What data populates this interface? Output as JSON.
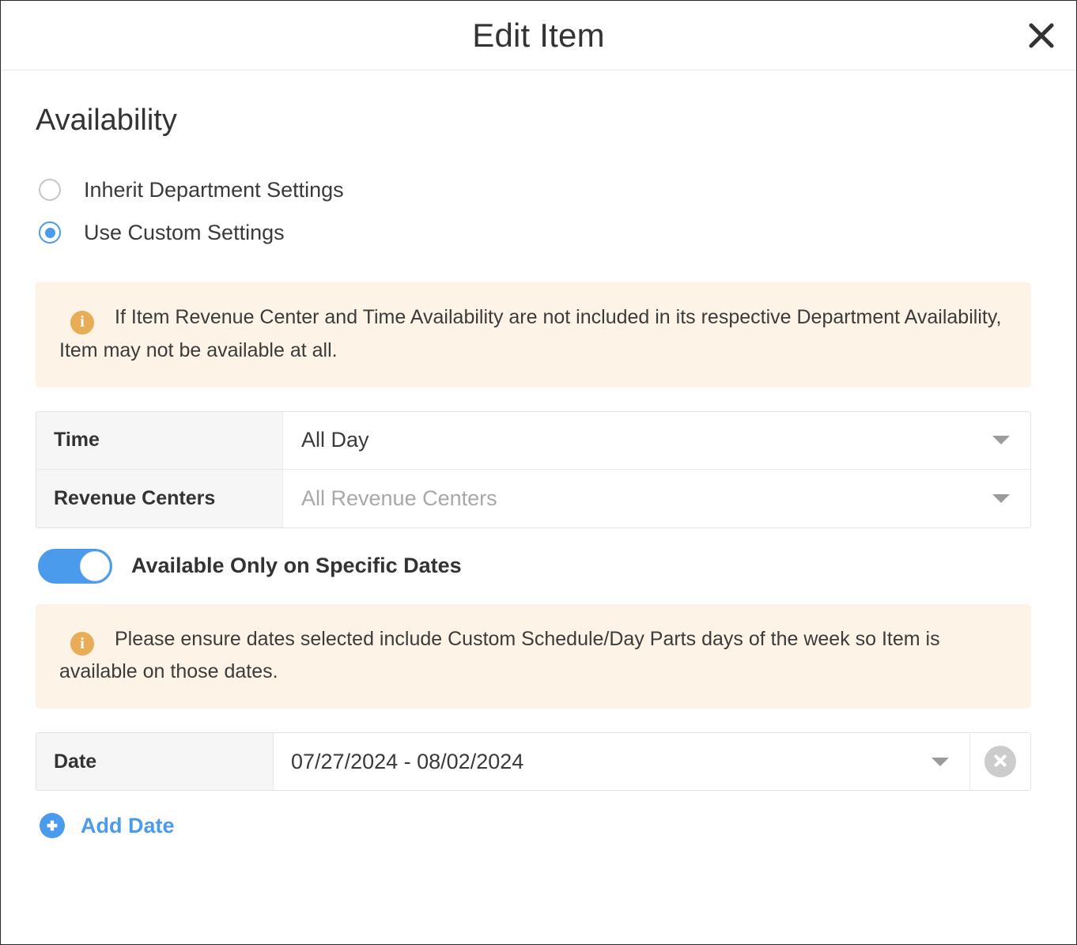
{
  "header": {
    "title": "Edit Item",
    "close_icon": "close-icon"
  },
  "section": {
    "title": "Availability"
  },
  "availability_mode": {
    "options": [
      {
        "label": "Inherit Department Settings",
        "selected": false
      },
      {
        "label": "Use Custom Settings",
        "selected": true
      }
    ]
  },
  "banners": [
    {
      "icon": "info-icon",
      "text": "If Item Revenue Center and Time Availability are not included in its respective Department Availability, Item may not be available at all."
    },
    {
      "icon": "info-icon",
      "text": "Please ensure dates selected include Custom Schedule/Day Parts days of the week so Item is available on those dates."
    }
  ],
  "fields": [
    {
      "label": "Time",
      "value": "All Day",
      "is_placeholder": false,
      "caret": "chevron-down-icon"
    },
    {
      "label": "Revenue Centers",
      "value": "All Revenue Centers",
      "is_placeholder": true,
      "caret": "chevron-down-icon"
    }
  ],
  "specific_dates_toggle": {
    "label": "Available Only on Specific Dates",
    "on": true
  },
  "date_row": {
    "label": "Date",
    "value": "07/27/2024 - 08/02/2024",
    "caret": "chevron-down-icon",
    "remove_icon": "remove-circle-icon"
  },
  "add_date": {
    "label": "Add Date",
    "icon": "plus-circle-icon"
  },
  "colors": {
    "accent_blue": "#4a9bec",
    "banner_bg": "#fdf4e7",
    "banner_icon": "#e8ad56",
    "label_cell_bg": "#f6f6f6",
    "remove_gray": "#cccccc"
  }
}
